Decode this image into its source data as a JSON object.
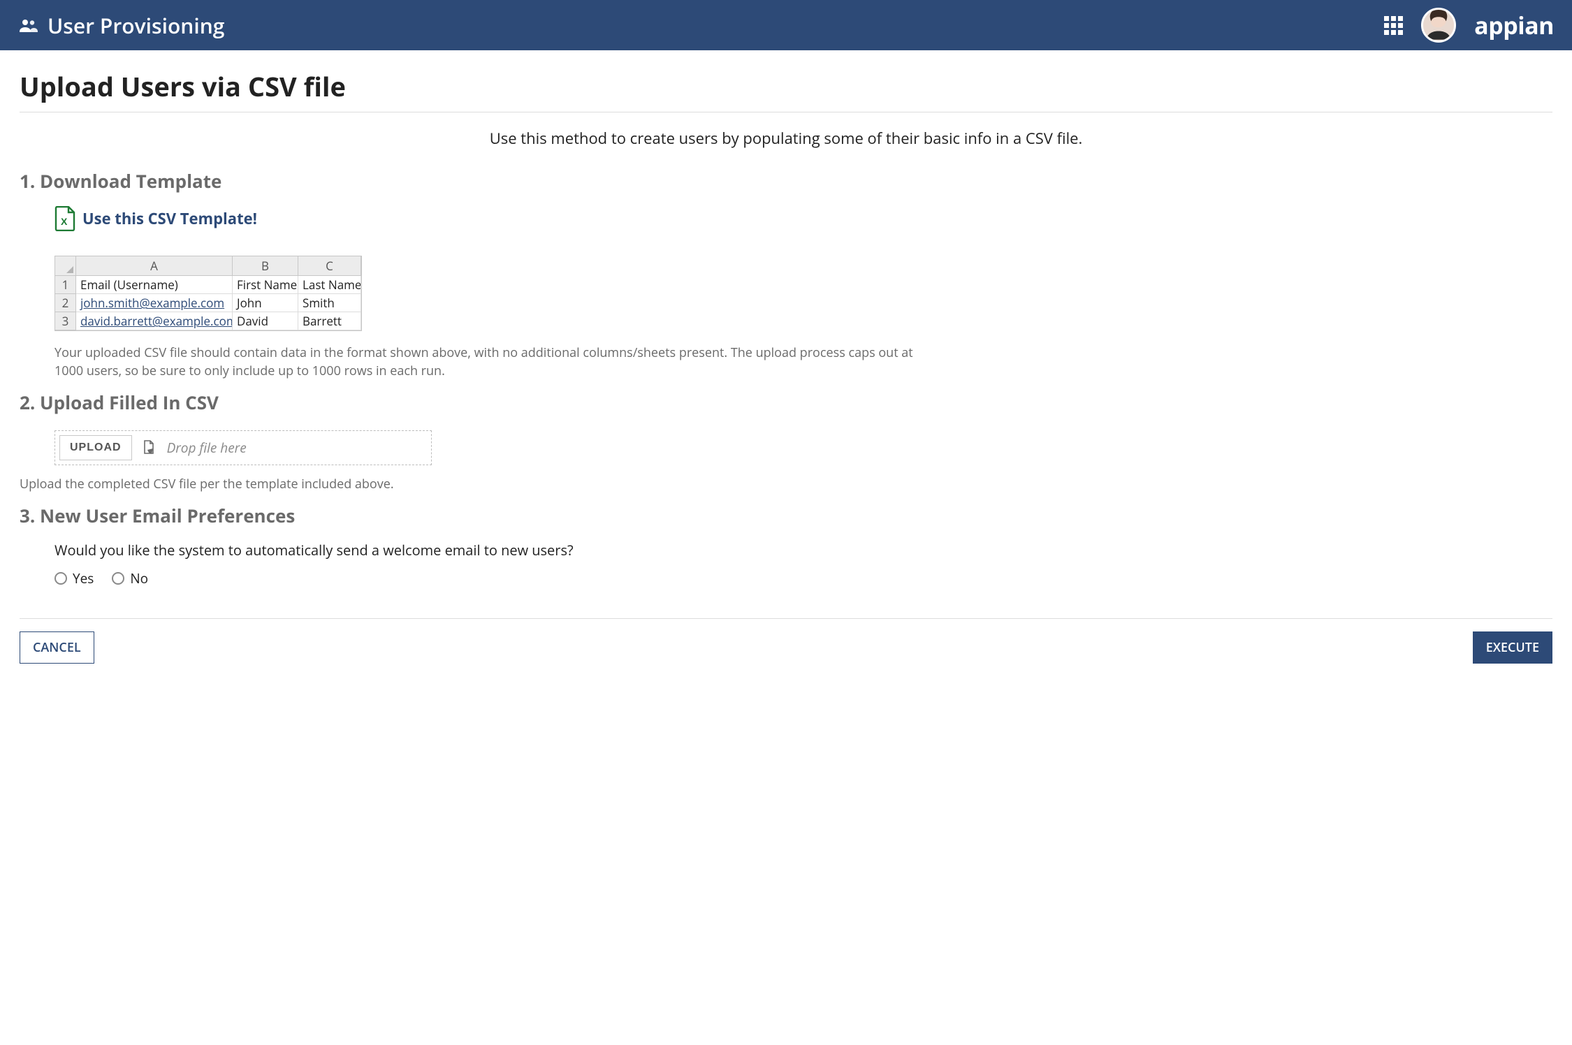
{
  "header": {
    "title": "User Provisioning",
    "logo_text": "appian"
  },
  "page": {
    "title": "Upload Users via CSV file",
    "intro": "Use this method to create users by populating some of their basic info in a CSV file."
  },
  "section1": {
    "heading": "1. Download Template",
    "link_label": "Use this CSV Template!",
    "helper": "Your uploaded CSV file should contain data in the format shown above, with no additional columns/sheets present. The upload process caps out at 1000 users, so be sure to only include up to 1000 rows in each run."
  },
  "spreadsheet": {
    "col_letters": [
      "A",
      "B",
      "C"
    ],
    "row_numbers": [
      "1",
      "2",
      "3"
    ],
    "headers": [
      "Email (Username)",
      "First Name",
      "Last Name"
    ],
    "rows": [
      [
        "john.smith@example.com",
        "John",
        "Smith"
      ],
      [
        "david.barrett@example.com",
        "David",
        "Barrett"
      ]
    ]
  },
  "section2": {
    "heading": "2. Upload Filled In CSV",
    "upload_button": "UPLOAD",
    "drop_hint": "Drop file here",
    "helper": "Upload the completed CSV file per the template included above."
  },
  "section3": {
    "heading": "3. New User Email Preferences",
    "question": "Would you like the system to automatically send a welcome email to new users?",
    "option_yes": "Yes",
    "option_no": "No"
  },
  "footer": {
    "cancel": "CANCEL",
    "execute": "EXECUTE"
  }
}
